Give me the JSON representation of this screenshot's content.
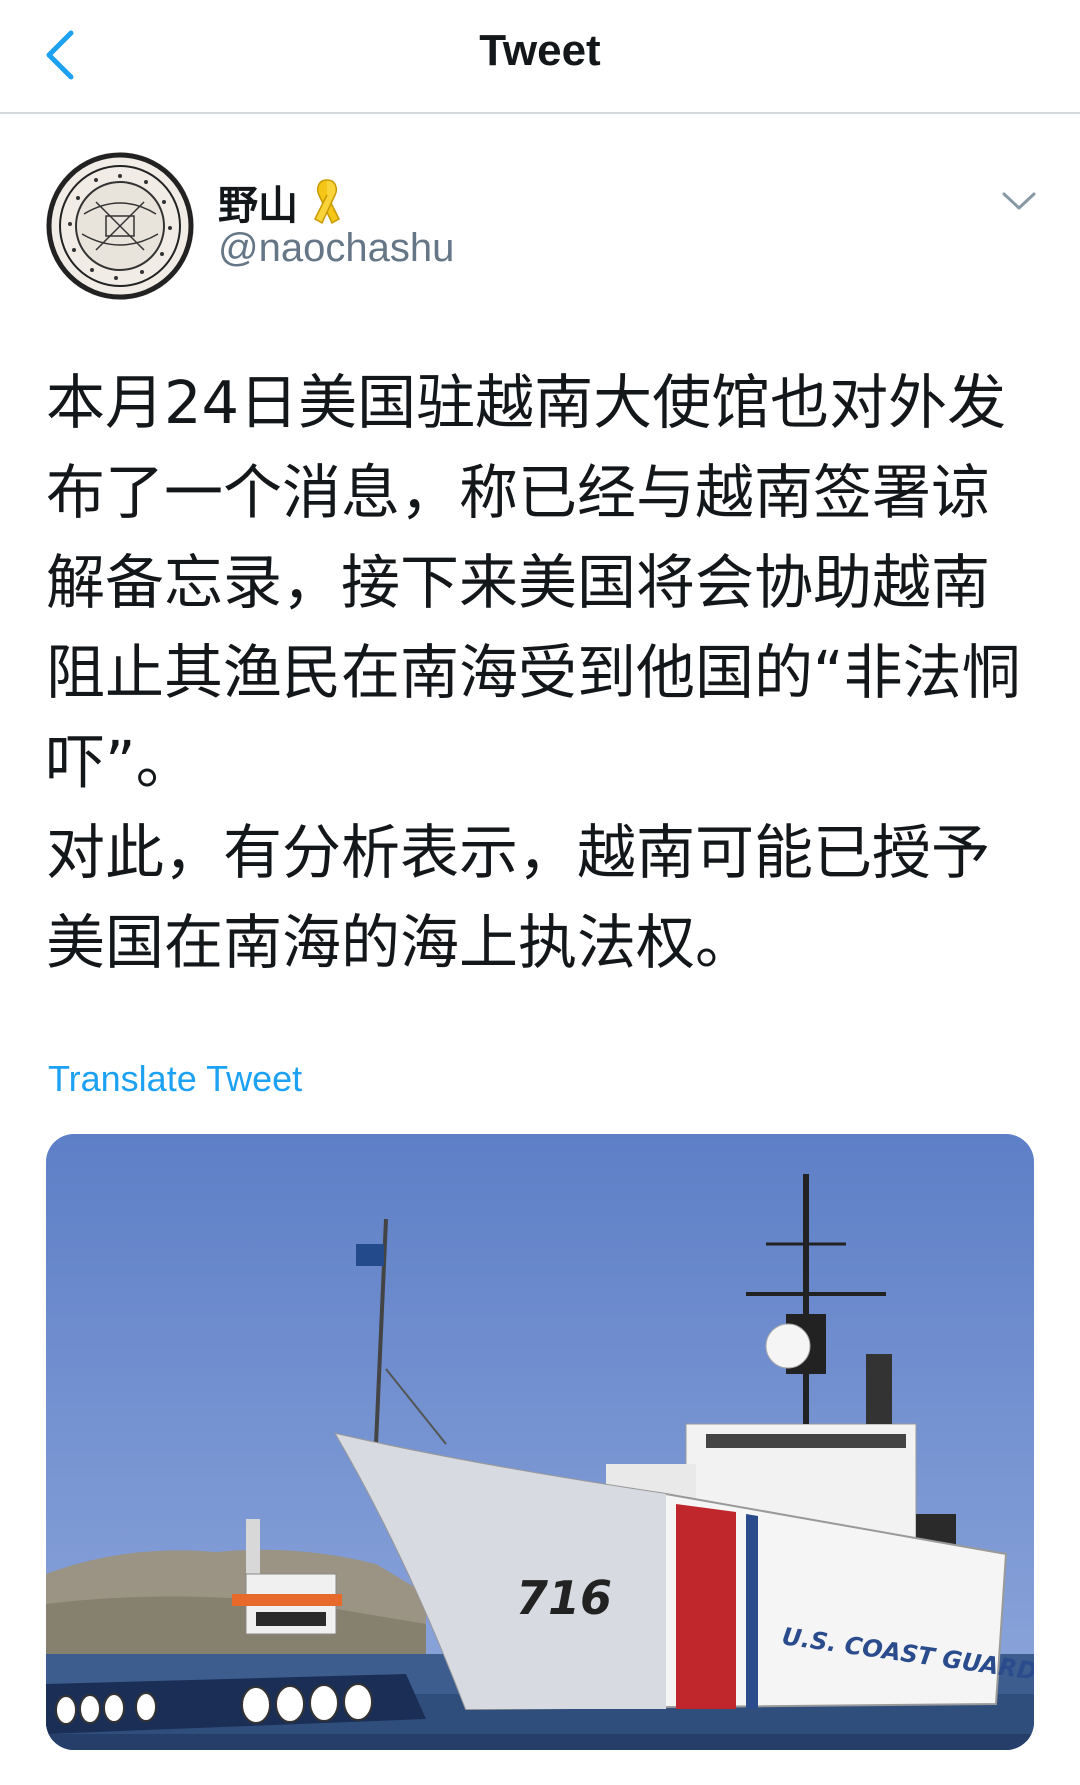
{
  "header": {
    "title": "Tweet",
    "back_icon": "chevron-left-icon"
  },
  "tweet": {
    "author_name": "野山",
    "ribbon_icon": "yellow-ribbon-icon",
    "handle": "@naochashu",
    "menu_icon": "chevron-down-icon",
    "paragraphs": [
      "本月24日美国驻越南大使馆也对外发布了一个消息，称已经与越南签署谅解备忘录，接下来美国将会协助越南阻止其渔民在南海受到他国的“非法恫吓”。",
      "对此，有分析表示，越南可能已授予美国在南海的海上执法权。"
    ],
    "translate_label": "Translate Tweet",
    "media": {
      "hull_number": "716",
      "hull_text": "U.S. COAST GUARD"
    }
  },
  "colors": {
    "accent": "#1da1f2",
    "text": "#14171a",
    "secondary": "#657786",
    "divider": "#d6d9dc"
  }
}
